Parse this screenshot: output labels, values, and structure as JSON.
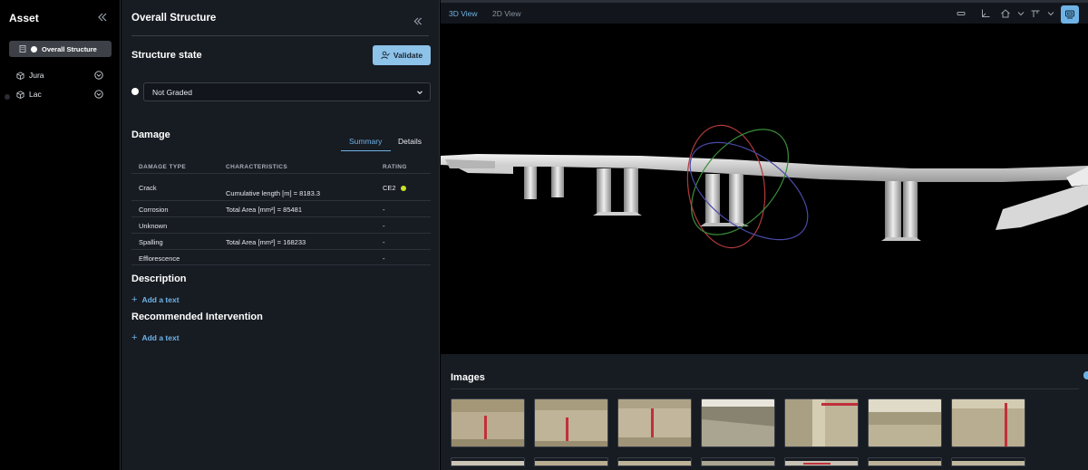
{
  "asset_panel": {
    "title": "Asset",
    "selected_item": "Overall Structure",
    "items": [
      {
        "label": "Jura"
      },
      {
        "label": "Lac"
      }
    ]
  },
  "detail_panel": {
    "title": "Overall Structure",
    "structure_state": {
      "title": "Structure state",
      "validate_label": "Validate",
      "grade_value": "Not Graded"
    },
    "damage": {
      "title": "Damage",
      "tabs": [
        "Summary",
        "Details"
      ],
      "active_tab": "Summary",
      "columns": [
        "DAMAGE TYPE",
        "CHARACTERISTICS",
        "RATING"
      ],
      "rows": [
        {
          "type": "Crack",
          "characteristics": "Cumulative length [m] = 8183.3",
          "rating": "CE2",
          "rating_color": "#c9e02a"
        },
        {
          "type": "Corrosion",
          "characteristics": "Total Area [mm²] = 85481",
          "rating": "-"
        },
        {
          "type": "Unknown",
          "characteristics": "",
          "rating": "-"
        },
        {
          "type": "Spalling",
          "characteristics": "Total Area [mm²] = 168233",
          "rating": "-"
        },
        {
          "type": "Efflorescence",
          "characteristics": "",
          "rating": "-"
        }
      ]
    },
    "description": {
      "title": "Description",
      "add_label": "Add a text"
    },
    "recommended": {
      "title": "Recommended Intervention",
      "add_label": "Add a text"
    }
  },
  "view_panel": {
    "tabs": [
      "3D View",
      "2D View"
    ],
    "active_tab": "3D View",
    "toolbar_icons": [
      "frame-icon",
      "axes-icon",
      "home-icon",
      "chevron-down-icon",
      "measure-icon",
      "chevron-down-icon",
      "layers-icon"
    ],
    "images_title": "Images",
    "image_count_visible_row": 7
  },
  "colors": {
    "accent": "#6fb3e6",
    "validate_bg": "#8dc2e9",
    "panel_bg": "#171b22",
    "rating_ce2": "#c9e02a"
  }
}
